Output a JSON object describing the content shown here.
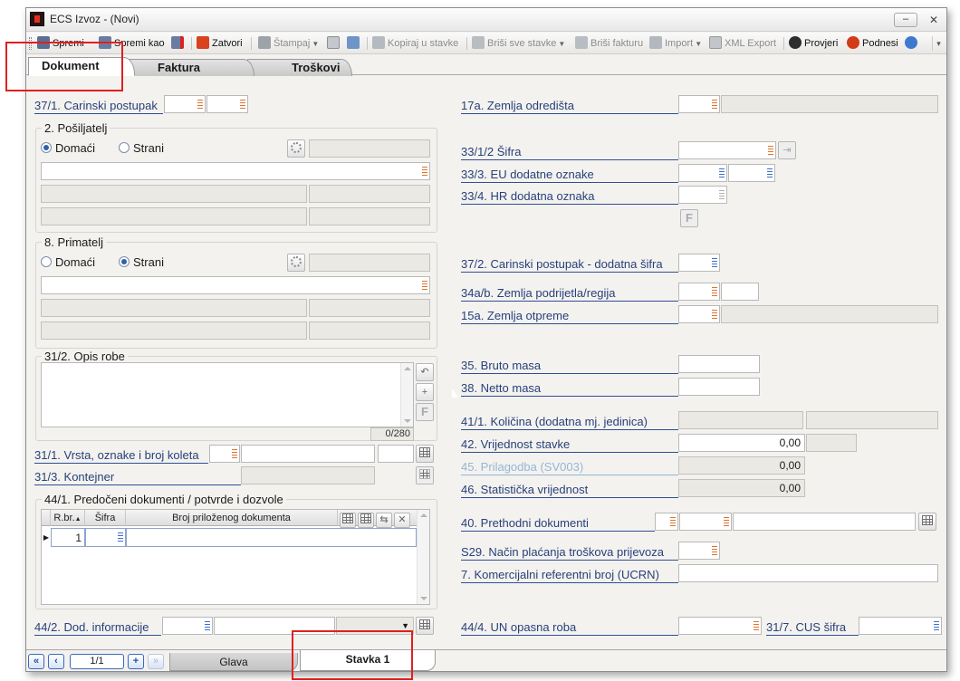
{
  "window": {
    "title": "ECS Izvoz - (Novi)",
    "minimize": "–",
    "close": "✕"
  },
  "toolbar": {
    "save": "Spremi",
    "save_as": "Spremi kao",
    "close": "Zatvori",
    "print": "Štampaj",
    "copy_to_items": "Kopiraj u stavke",
    "delete_all_items": "Briši sve stavke",
    "delete_invoice": "Briši fakturu",
    "import": "Import",
    "xml_export": "XML Export",
    "check": "Provjeri",
    "submit": "Podnesi",
    "more": "▾"
  },
  "tabs": [
    "Dokument",
    "Faktura",
    "Troškovi"
  ],
  "left": {
    "customs_procedure": "37/1. Carinski postupak",
    "sender": {
      "title": "2. Pošiljatelj",
      "domestic": "Domaći",
      "foreign": "Strani"
    },
    "receiver": {
      "title": "8. Primatelj",
      "domestic": "Domaći",
      "foreign": "Strani"
    },
    "goods_description": {
      "title": "31/2. Opis robe",
      "counter": "0/280"
    },
    "packages": "31/1. Vrsta, oznake i broj koleta",
    "container": "31/3. Kontejner",
    "documents": {
      "title": "44/1. Predočeni dokumenti / potvrde i dozvole",
      "columns": [
        "R.br.",
        "Šifra",
        "Broj priloženog dokumenta"
      ],
      "rows": [
        {
          "rbr": "1",
          "sifra": "",
          "broj": ""
        }
      ]
    },
    "additional_info": "44/2. Dod. informacije"
  },
  "right": {
    "destination_country": "17a. Zemlja odredišta",
    "code": "33/1/2 Šifra",
    "eu_codes": "33/3. EU dodatne oznake",
    "hr_code": "33/4. HR dodatna oznaka",
    "f_button": "F",
    "procedure_extra": "37/2. Carinski postupak - dodatna šifra",
    "origin_country": "34a/b. Zemlja podrijetla/regija",
    "dispatch_country": "15a. Zemlja otpreme",
    "gross_mass": "35. Bruto masa",
    "net_mass": "38. Netto masa",
    "quantity": "41/1. Količina (dodatna mj. jedinica)",
    "item_value": "42. Vrijednost stavke",
    "item_value_val": "0,00",
    "adjustment": "45. Prilagodba (SV003)",
    "adjustment_val": "0,00",
    "statistical_value": "46. Statistička vrijednost",
    "statistical_value_val": "0,00",
    "previous_documents": "40. Prethodni dokumenti",
    "transport_payment": "S29. Način plaćanja troškova prijevoza",
    "ucrn": "7. Komercijalni referentni broj (UCRN)",
    "un_dangerous": "44/4. UN opasna roba",
    "cus_code": "31/7. CUS šifra"
  },
  "bottom": {
    "pager": "1/1",
    "tabs": [
      "Glava",
      "Stavka 1"
    ]
  },
  "colors": {
    "highlight": "#e02020",
    "label": "#27417a",
    "accent": "#3a6bbd"
  }
}
